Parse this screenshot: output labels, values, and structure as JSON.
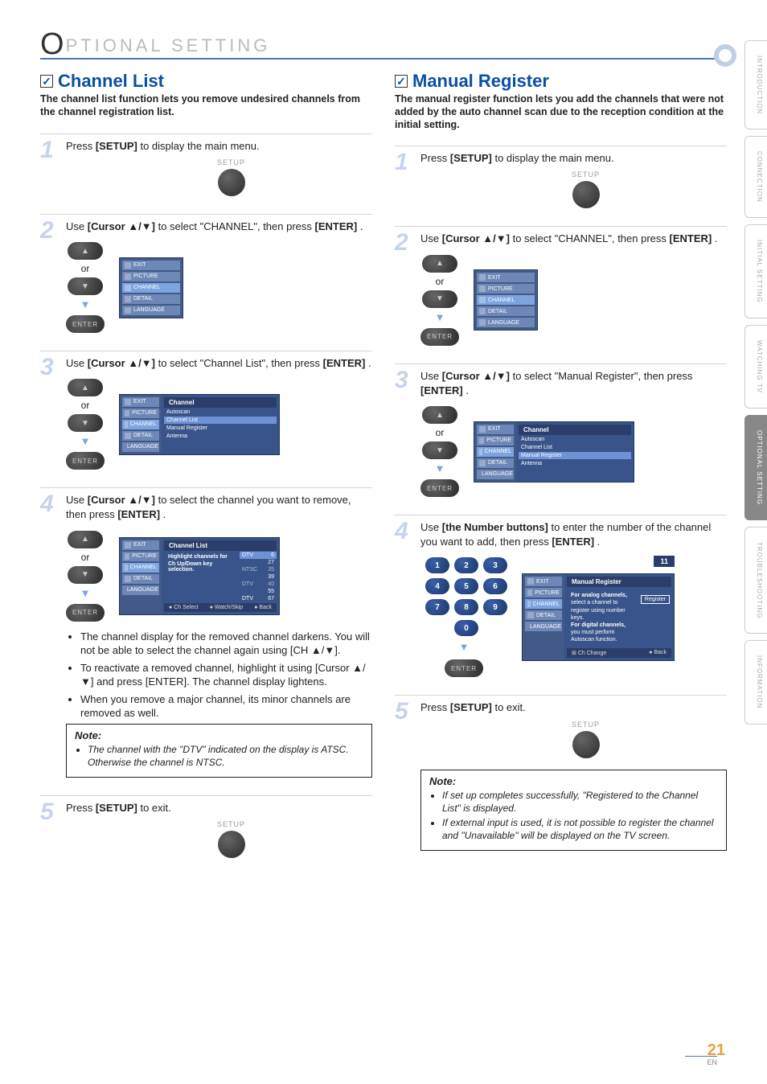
{
  "page": {
    "header_title": "PTIONAL  SETTING",
    "number": "21",
    "lang": "EN"
  },
  "side_tabs": [
    {
      "label": "INTRODUCTION",
      "active": false
    },
    {
      "label": "CONNECTION",
      "active": false
    },
    {
      "label": "INITIAL SETTING",
      "active": false
    },
    {
      "label": "WATCHING TV",
      "active": false
    },
    {
      "label": "OPTIONAL SETTING",
      "active": true
    },
    {
      "label": "TROUBLESHOOTING",
      "active": false
    },
    {
      "label": "INFORMATION",
      "active": false
    }
  ],
  "left": {
    "title": "Channel List",
    "desc": "The channel list function lets you remove undesired channels from the channel registration list.",
    "steps": {
      "s1_pre": "Press ",
      "s1_key": "[SETUP]",
      "s1_post": " to display the main menu.",
      "setup_label": "SETUP",
      "s2_a": "Use ",
      "s2_key": "[Cursor ▲/▼]",
      "s2_b": " to select \"CHANNEL\", then press ",
      "s2_enter": "[ENTER]",
      "s2_c": ".",
      "or": "or",
      "enter_lbl": "ENTER",
      "menu_items": [
        "EXIT",
        "PICTURE",
        "CHANNEL",
        "DETAIL",
        "LANGUAGE"
      ],
      "s3_a": "Use ",
      "s3_key": "[Cursor ▲/▼]",
      "s3_b": " to select \"Channel List\", then press ",
      "s3_enter": "[ENTER]",
      "s3_c": ".",
      "osd3_title": "Channel",
      "osd3_items": [
        "Autoscan",
        "Channel List",
        "Manual Register",
        "Antenna"
      ],
      "osd3_sel": "Channel List",
      "s4_a": "Use ",
      "s4_key": "[Cursor ▲/▼]",
      "s4_b": " to select the channel you want to remove, then press ",
      "s4_enter": "[ENTER]",
      "s4_c": ".",
      "osd4_title": "Channel List",
      "osd4_hint1": "Highlight channels for",
      "osd4_hint2": "Ch Up/Down key selection.",
      "osd4_rows": [
        {
          "t": "DTV",
          "n": "6"
        },
        {
          "t": "",
          "n": "27"
        },
        {
          "t": "NTSC",
          "n": "35"
        },
        {
          "t": "",
          "n": "39"
        },
        {
          "t": "DTV",
          "n": "40"
        },
        {
          "t": "",
          "n": "55"
        },
        {
          "t": "DTV",
          "n": "67"
        }
      ],
      "osd4_foot": [
        "Ch Select",
        "Watch/Skip",
        "Back"
      ],
      "bullets": [
        "The channel display for the removed channel darkens. You will not be able to select the channel again using [CH ▲/▼].",
        "To reactivate a removed channel, highlight it using [Cursor ▲/▼] and press [ENTER]. The channel display lightens.",
        "When you remove a major channel, its minor channels are removed as well."
      ],
      "note_title": "Note:",
      "note_items": [
        "The channel with the \"DTV\" indicated on the display is ATSC. Otherwise the channel is NTSC."
      ],
      "s5_a": "Press ",
      "s5_key": "[SETUP]",
      "s5_b": " to exit."
    }
  },
  "right": {
    "title": "Manual Register",
    "desc": "The manual register function lets you add the channels that were not added by the auto channel scan due to the reception condition at the initial setting.",
    "steps": {
      "s1_pre": "Press ",
      "s1_key": "[SETUP]",
      "s1_post": " to display the main menu.",
      "setup_label": "SETUP",
      "s2_a": "Use ",
      "s2_key": "[Cursor ▲/▼]",
      "s2_b": " to select \"CHANNEL\", then press ",
      "s2_enter": "[ENTER]",
      "s2_c": ".",
      "or": "or",
      "enter_lbl": "ENTER",
      "menu_items": [
        "EXIT",
        "PICTURE",
        "CHANNEL",
        "DETAIL",
        "LANGUAGE"
      ],
      "s3_a": "Use ",
      "s3_key": "[Cursor ▲/▼]",
      "s3_b": " to select \"Manual Register\", then press ",
      "s3_enter": "[ENTER]",
      "s3_c": ".",
      "osd3_title": "Channel",
      "osd3_items": [
        "Autoscan",
        "Channel List",
        "Manual Register",
        "Antenna"
      ],
      "osd3_sel": "Manual Register",
      "s4_a": "Use ",
      "s4_key": "[the Number buttons]",
      "s4_b": " to enter the number of the channel you want to add, then press ",
      "s4_enter": "[ENTER]",
      "s4_c": ".",
      "num_labels": [
        "1",
        "2",
        "3",
        "4",
        "5",
        "6",
        "7",
        "8",
        "9",
        "0"
      ],
      "osd4_title": "Manual Register",
      "osd4_ch": "11",
      "osd4_txt1": "For analog channels,",
      "osd4_txt2": "select a channel to register using number keys.",
      "osd4_txt3": "For digital channels,",
      "osd4_txt4": "you must perform Autoscan function.",
      "osd4_reg": "Register",
      "osd4_foot": [
        "Ch Change",
        "Back"
      ],
      "s5_a": "Press ",
      "s5_key": "[SETUP]",
      "s5_b": " to exit.",
      "note_title": "Note:",
      "note_items": [
        "If set up completes successfully, \"Registered to the Channel List\" is displayed.",
        "If external input is used, it is not possible to register the channel and \"Unavailable\" will be displayed on the TV screen."
      ]
    }
  }
}
